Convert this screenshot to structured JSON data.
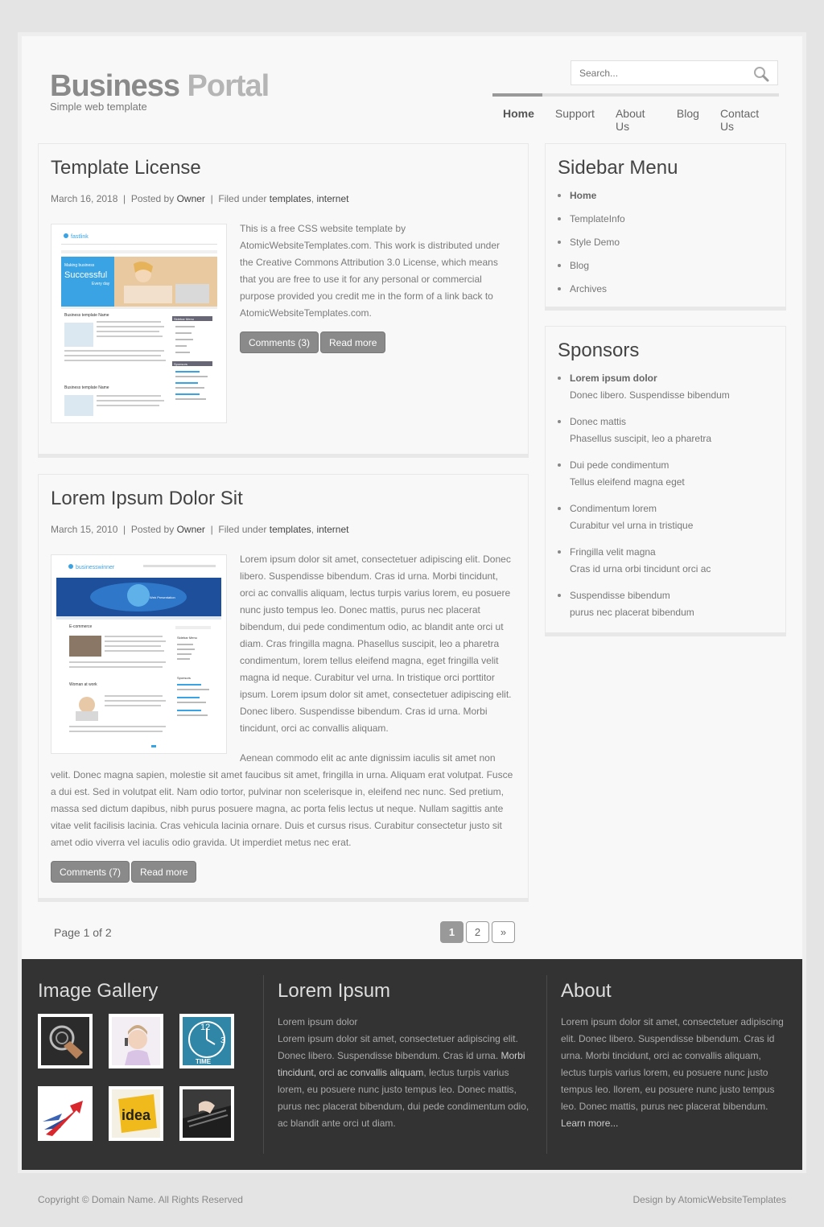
{
  "header": {
    "logo_bold": "Business",
    "logo_light": " Portal",
    "tagline": "Simple web template",
    "search_placeholder": "Search..."
  },
  "nav": {
    "items": [
      {
        "label": "Home",
        "active": true
      },
      {
        "label": "Support"
      },
      {
        "label": "About Us"
      },
      {
        "label": "Blog"
      },
      {
        "label": "Contact Us"
      }
    ]
  },
  "posts": [
    {
      "title": "Template License",
      "date": "March 16, 2018",
      "posted_by_label": "Posted by",
      "author": "Owner",
      "filed_label": "Filed under",
      "tag1": "templates",
      "tag2": "internet",
      "body": "This is a free CSS website template by AtomicWebsiteTemplates.com. This work is distributed under the Creative Commons Attribution 3.0 License, which means that you are free to use it for any personal or commercial purpose provided you credit me in the form of a link back to AtomicWebsiteTemplates.com.",
      "comments_btn": "Comments (3)",
      "readmore_btn": "Read more",
      "thumb_brand": "fastlink",
      "thumb_headline": "Successful",
      "thumb_kicker": "Making business",
      "thumb_tag": "Every day",
      "thumb_section": "Business template Name",
      "thumb_menu": "Sidebar Menu",
      "thumb_sponsors": "Sponsors"
    },
    {
      "title": "Lorem Ipsum Dolor Sit",
      "date": "March 15, 2010",
      "posted_by_label": "Posted by",
      "author": "Owner",
      "filed_label": "Filed under",
      "tag1": "templates",
      "tag2": "internet",
      "body_a": "Lorem ipsum dolor sit amet, consectetuer adipiscing elit. Donec libero. Suspendisse bibendum. Cras id urna. ",
      "body_link": "Morbi tincidunt, orci ac convallis aliquam, lectus turpis varius lorem, eu posuere nunc justo tempus leo.",
      "body_b": " Donec mattis, purus nec placerat bibendum, dui pede condimentum odio, ac blandit ante orci ut diam. Cras fringilla magna. Phasellus suscipit, leo a pharetra condimentum, lorem tellus eleifend magna, eget fringilla velit magna id neque. Curabitur vel urna. In tristique orci porttitor ipsum. Lorem ipsum dolor sit amet, consectetuer adipiscing elit. Donec libero. Suspendisse bibendum. Cras id urna. Morbi tincidunt, orci ac convallis aliquam.",
      "body_c_indent": "Aenean commodo elit ac ante dignissim iaculis sit amet non",
      "body_c": "velit. Donec magna sapien, molestie sit amet faucibus sit amet, fringilla in urna. Aliquam erat volutpat. Fusce a dui est. Sed in volutpat elit. Nam odio tortor, pulvinar non scelerisque in, eleifend nec nunc. Sed pretium, massa sed dictum dapibus, nibh purus posuere magna, ac porta felis lectus ut neque. Nullam sagittis ante vitae velit facilisis lacinia. Cras vehicula lacinia ornare. Duis et cursus risus. Curabitur consectetur justo sit amet odio viverra vel iaculis odio gravida. Ut imperdiet metus nec erat.",
      "comments_btn": "Comments (7)",
      "readmore_btn": "Read more",
      "thumb_brand": "businesswinner",
      "thumb_banner": "Web Presentation",
      "thumb_section1": "E-commerce",
      "thumb_section2": "Woman at work",
      "thumb_menu": "Sidebar Menu",
      "thumb_sponsors": "Sponsors"
    }
  ],
  "pagination": {
    "label": "Page 1 of 2",
    "pages": [
      "1",
      "2",
      "»"
    ]
  },
  "sidebar_menu": {
    "title": "Sidebar Menu",
    "items": [
      "Home",
      "TemplateInfo",
      "Style Demo",
      "Blog",
      "Archives"
    ]
  },
  "sponsors": {
    "title": "Sponsors",
    "items": [
      {
        "title": "Lorem ipsum dolor",
        "desc": "Donec libero. Suspendisse bibendum"
      },
      {
        "title": "Donec mattis",
        "desc": "Phasellus suscipit, leo a pharetra"
      },
      {
        "title": "Dui pede condimentum",
        "desc": "Tellus eleifend magna eget"
      },
      {
        "title": "Condimentum lorem",
        "desc": "Curabitur vel urna in tristique"
      },
      {
        "title": "Fringilla velit magna",
        "desc": "Cras id urna orbi tincidunt orci ac"
      },
      {
        "title": "Suspendisse bibendum",
        "desc": "purus nec placerat bibendum"
      }
    ]
  },
  "footer": {
    "gallery_title": "Image Gallery",
    "gallery_icons": [
      "gear-hand-icon",
      "woman-headset-icon",
      "clock-time-icon",
      "arrows-icon",
      "idea-icon",
      "keyboard-hands-icon"
    ],
    "gallery_clock_label": "TIME",
    "gallery_idea_label": "idea",
    "lorem_title": "Lorem Ipsum",
    "lorem_first": "Lorem ipsum dolor",
    "lorem_a": "Lorem ipsum dolor sit amet, consectetuer adipiscing elit. Donec libero. Suspendisse bibendum. Cras id urna. ",
    "lorem_link": "Morbi tincidunt, orci ac convallis aliquam",
    "lorem_b": ", lectus turpis varius lorem, eu posuere nunc justo tempus leo. Donec mattis, purus nec placerat bibendum, dui pede condimentum odio, ac blandit ante orci ut diam.",
    "about_title": "About",
    "about_text": "Lorem ipsum dolor sit amet, consectetuer adipiscing elit. Donec libero. Suspendisse bibendum. Cras id urna. Morbi tincidunt, orci ac convallis aliquam, lectus turpis varius lorem, eu posuere nunc justo tempus leo. llorem, eu posuere nunc justo tempus leo. Donec mattis, purus nec placerat bibendum.",
    "about_link": "Learn more..."
  },
  "bottom": {
    "copyright": "Copyright © Domain Name. All Rights Reserved",
    "design": "Design by AtomicWebsiteTemplates"
  },
  "colors": {
    "page_bg": "#e4e4e4",
    "footer_bg": "#333333",
    "button_bg": "#8a8a8a",
    "thumb_blue": "#3aa3e3"
  }
}
